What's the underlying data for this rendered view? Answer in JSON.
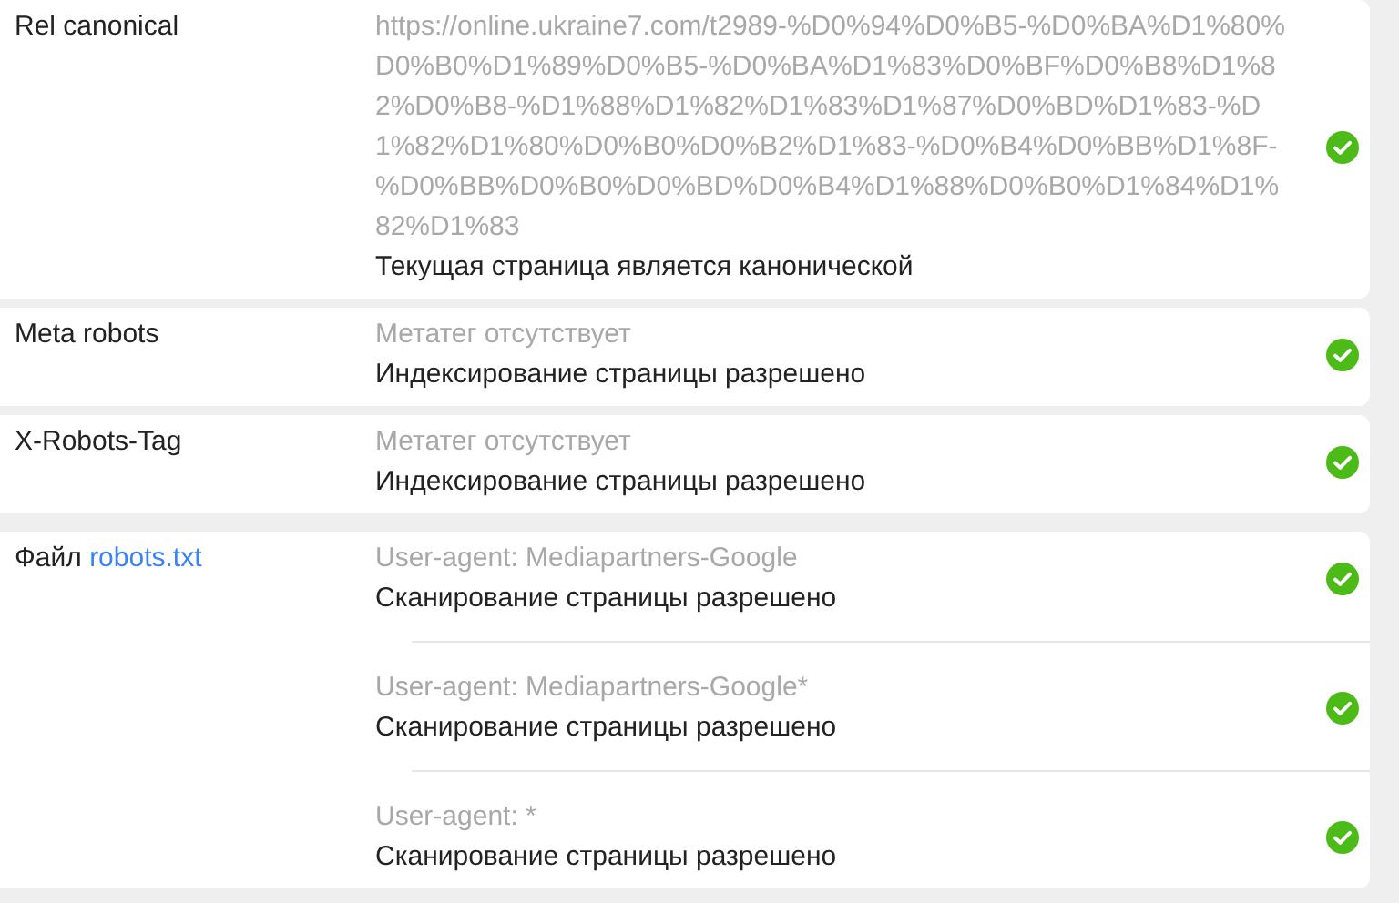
{
  "rows": [
    {
      "label": "Rel canonical",
      "entries": [
        {
          "detail": "https://online.ukraine7.com/t2989-%D0%94%D0%B5-%D0%BA%D1%80%D0%B0%D1%89%D0%B5-%D0%BA%D1%83%D0%BF%D0%B8%D1%82%D0%B8-%D1%88%D1%82%D1%83%D1%87%D0%BD%D1%83-%D1%82%D1%80%D0%B0%D0%B2%D1%83-%D0%B4%D0%BB%D1%8F-%D0%BB%D0%B0%D0%BD%D0%B4%D1%88%D0%B0%D1%84%D1%82%D1%83",
          "result": "Текущая страница является канонической",
          "passed": true
        }
      ]
    },
    {
      "label": "Meta robots",
      "entries": [
        {
          "detail": "Метатег отсутствует",
          "result": "Индексирование страницы разрешено",
          "passed": true
        }
      ]
    },
    {
      "label": "X-Robots-Tag",
      "entries": [
        {
          "detail": "Метатег отсутствует",
          "result": "Индексирование страницы разрешено",
          "passed": true
        }
      ]
    },
    {
      "label": "Файл",
      "link": "robots.txt",
      "entries": [
        {
          "detail": "User-agent: Mediapartners-Google",
          "result": "Сканирование страницы разрешено",
          "passed": true
        },
        {
          "detail": "User-agent: Mediapartners-Google*",
          "result": "Сканирование страницы разрешено",
          "passed": true
        },
        {
          "detail": "User-agent: *",
          "result": "Сканирование страницы разрешено",
          "passed": true
        }
      ]
    }
  ]
}
